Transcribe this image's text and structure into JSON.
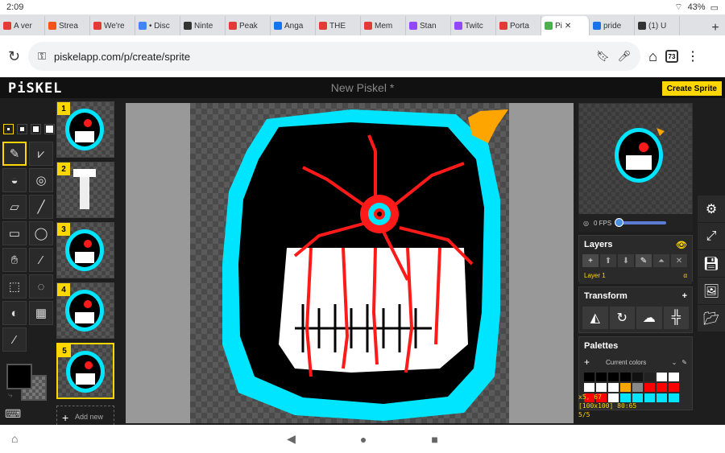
{
  "status": {
    "time": "2:09",
    "battery": "43%"
  },
  "tabs": [
    {
      "label": "A ver",
      "color": "#e53935"
    },
    {
      "label": "Strea",
      "color": "#f4511e"
    },
    {
      "label": "We're",
      "color": "#e53935"
    },
    {
      "label": "• Disc",
      "color": "#4285f4"
    },
    {
      "label": "Ninte",
      "color": "#333333"
    },
    {
      "label": "Peak",
      "color": "#e53935"
    },
    {
      "label": "Anga",
      "color": "#1a73e8"
    },
    {
      "label": "THE",
      "color": "#e53935"
    },
    {
      "label": "Mem",
      "color": "#e53935"
    },
    {
      "label": "Stan",
      "color": "#9146ff"
    },
    {
      "label": "Twitc",
      "color": "#9146ff"
    },
    {
      "label": "Porta",
      "color": "#e53935"
    },
    {
      "label": "Pi",
      "color": "#4caf50",
      "active": true
    },
    {
      "label": "pride",
      "color": "#1a73e8"
    },
    {
      "label": "(1) U",
      "color": "#333333"
    }
  ],
  "omnibox": {
    "url": "piskelapp.com/p/create/sprite",
    "tab_count": "73"
  },
  "app": {
    "logo": "PiSKEL",
    "title": "New Piskel *",
    "create_button": "Create Sprite"
  },
  "frames": [
    {
      "num": "1",
      "selected": false
    },
    {
      "num": "2",
      "selected": false
    },
    {
      "num": "3",
      "selected": false
    },
    {
      "num": "4",
      "selected": false
    },
    {
      "num": "5",
      "selected": true
    }
  ],
  "add_frame_label": "Add new",
  "fps_label": "0 FPS",
  "layers": {
    "title": "Layers",
    "layer_name": "Layer 1",
    "alpha": "α"
  },
  "transform": {
    "title": "Transform"
  },
  "palettes": {
    "title": "Palettes",
    "current": "Current colors",
    "swatches": [
      "#000000",
      "#000000",
      "#000000",
      "#000000",
      "#111111",
      "#222222",
      "#ffffff",
      "#ffffff",
      "#ffffff",
      "#ffffff",
      "#ffffff",
      "#ffa500",
      "#888888",
      "#ff0000",
      "#ff0000",
      "#ff0000",
      "#ff0000",
      "#ff0000",
      "#ffffff",
      "#00e5ff",
      "#00e5ff",
      "#00e5ff",
      "#00e5ff",
      "#00e5ff"
    ]
  },
  "coords": {
    "pos": "x5, 67",
    "size": "[100x100] 80:65",
    "frame": "5/5"
  }
}
